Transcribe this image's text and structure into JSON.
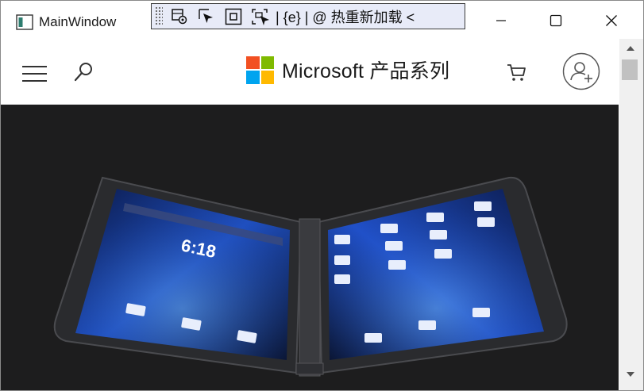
{
  "window": {
    "title": "MainWindow",
    "minimize": "minimize",
    "maximize": "maximize",
    "close": "close"
  },
  "debug_toolbar": {
    "text": "| {e} | @ 热重新加载 <",
    "icons": [
      "select-element-icon",
      "pointer-icon",
      "frame-icon",
      "track-focus-icon"
    ]
  },
  "navbar": {
    "brand": "Microsoft 产品系列",
    "logo_colors": [
      "#f25022",
      "#7fba00",
      "#00a4ef",
      "#ffb900"
    ],
    "icons": [
      "menu-icon",
      "search-icon",
      "cart-icon",
      "account-icon"
    ]
  },
  "hero": {
    "device_time": "6:18",
    "background": "#1d1d1e"
  }
}
